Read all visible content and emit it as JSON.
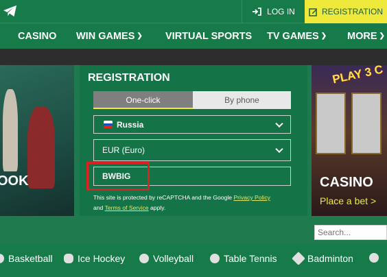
{
  "header": {
    "login_label": "LOG IN",
    "registration_label": "REGISTRATION"
  },
  "nav": {
    "items": [
      {
        "label": "CASINO",
        "dropdown": false
      },
      {
        "label": "WIN GAMES",
        "dropdown": true
      },
      {
        "label": "VIRTUAL SPORTS",
        "dropdown": false
      },
      {
        "label": "TV GAMES",
        "dropdown": true
      },
      {
        "label": "MORE",
        "dropdown": true
      }
    ]
  },
  "banners": {
    "left_text": "OOK",
    "right_slot_text": "PLAY 3 C",
    "right_title": "CASINO",
    "right_cta": "Place a bet >"
  },
  "registration": {
    "title": "REGISTRATION",
    "tabs": [
      "One-click",
      "By phone"
    ],
    "active_tab": "One-click",
    "country": "Russia",
    "currency": "EUR (Euro)",
    "promo_code": "BWBIG",
    "recaptcha_prefix": "This site is protected by reCAPTCHA and the Google",
    "privacy_link": "Privacy Policy",
    "and_text": "and",
    "terms_link": "Terms of Service",
    "apply_text": "apply."
  },
  "search": {
    "placeholder": "Search..."
  },
  "sports": {
    "items": [
      "Basketball",
      "Ice Hockey",
      "Volleyball",
      "Table Tennis",
      "Badminton"
    ]
  },
  "colors": {
    "brand_green": "#177a49",
    "accent_yellow": "#eee93b",
    "highlight_red": "#e02020"
  },
  "icons": {
    "top_left": "telegram-icon",
    "login": "login-arrow-icon",
    "registration": "edit-icon"
  }
}
